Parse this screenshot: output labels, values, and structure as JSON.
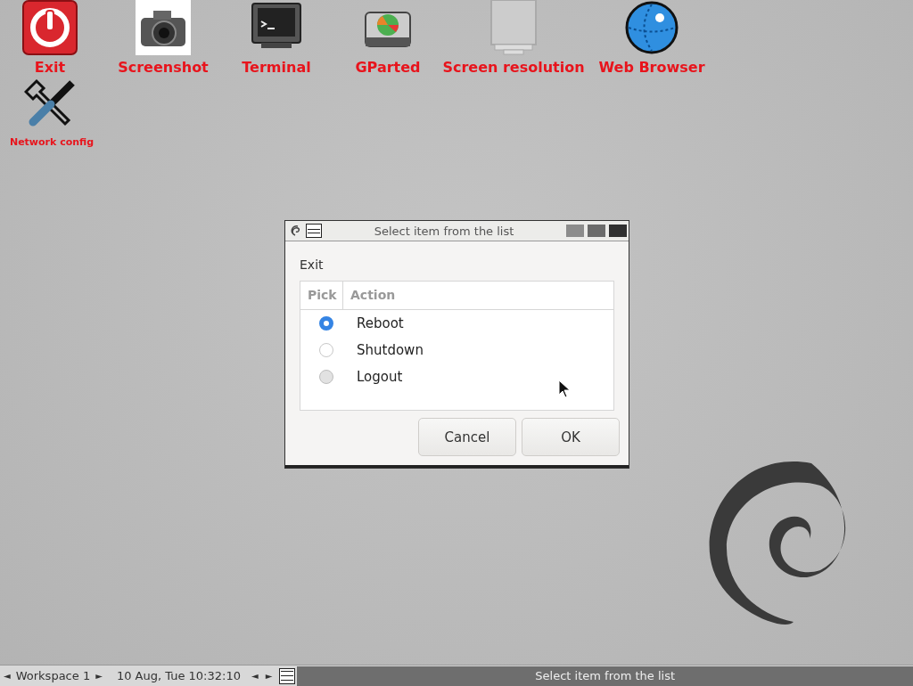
{
  "desktop_icons": [
    {
      "label": "Exit",
      "kind": "power"
    },
    {
      "label": "Screenshot",
      "kind": "camera"
    },
    {
      "label": "Terminal",
      "kind": "terminal"
    },
    {
      "label": "GParted",
      "kind": "disk"
    },
    {
      "label": "Screen resolution",
      "kind": "monitor"
    },
    {
      "label": "Web Browser",
      "kind": "globe"
    },
    {
      "label": "Network config",
      "kind": "tools"
    }
  ],
  "dialog": {
    "title": "Select item from the list",
    "prompt": "Exit",
    "columns": [
      "Pick",
      "Action"
    ],
    "rows": [
      {
        "action": "Reboot",
        "selected": true,
        "highlighted": false
      },
      {
        "action": "Shutdown",
        "selected": false,
        "highlighted": false
      },
      {
        "action": "Logout",
        "selected": false,
        "highlighted": true
      }
    ],
    "buttons": [
      "Cancel",
      "OK"
    ]
  },
  "taskbar": {
    "prev_workspace": "◄",
    "workspace": "Workspace 1",
    "next_workspace": "►",
    "clock": "10 Aug, Tue 10:32:10",
    "prev_task": "◄",
    "next_task": "►",
    "task": "Select item from the list"
  }
}
